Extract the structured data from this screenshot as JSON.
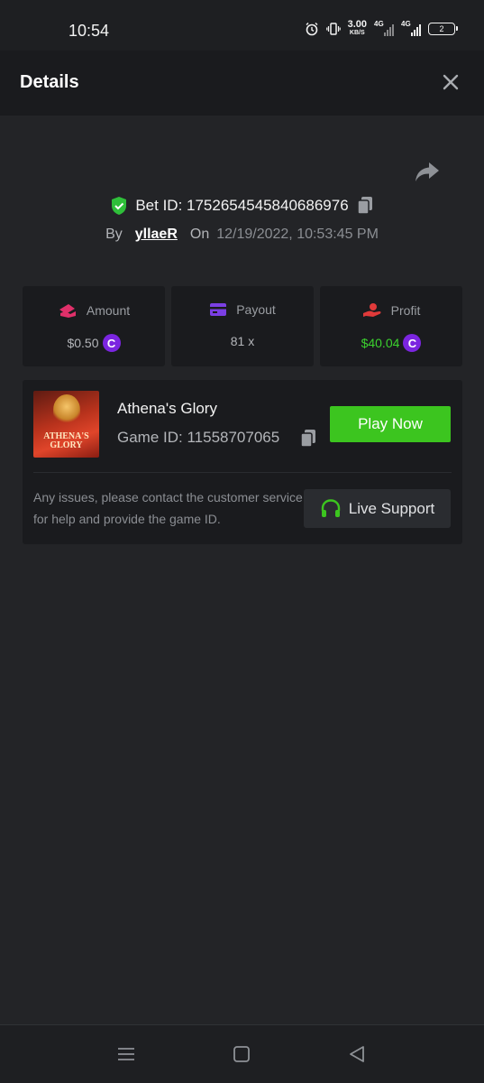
{
  "status_bar": {
    "time": "10:54",
    "net_speed": "3.00",
    "net_unit": "KB/S",
    "sim1_label": "4G",
    "sim2_label": "4G",
    "battery": "2"
  },
  "header": {
    "title": "Details"
  },
  "bet": {
    "bet_id_text": "Bet ID: 1752654545840686976",
    "by_label": "By",
    "username": "yllaeR",
    "on_label": "On",
    "datetime": "12/19/2022, 10:53:45 PM"
  },
  "stats": {
    "amount": {
      "label": "Amount",
      "value": "$0.50",
      "icon": "amount-icon",
      "color": "#e0306a"
    },
    "payout": {
      "label": "Payout",
      "value": "81 x",
      "icon": "card-icon",
      "color": "#7b3fe4"
    },
    "profit": {
      "label": "Profit",
      "value": "$40.04",
      "icon": "profit-hand-icon",
      "color": "#e03a3a"
    },
    "coin_symbol": "C",
    "coin_color": "#7b25e0",
    "profit_color": "#3bd12e"
  },
  "game": {
    "thumbnail_text": "ATHENA'S GLORY",
    "name": "Athena's Glory",
    "game_id_text": "Game ID: 11558707065",
    "play_label": "Play Now",
    "play_color": "#3cc51f",
    "issue_text": "Any issues, please contact the customer service for help and provide the game ID.",
    "support_label": "Live Support"
  },
  "nav": {
    "menu_icon": "menu-icon",
    "home_icon": "home-square-icon",
    "back_icon": "back-triangle-icon"
  }
}
